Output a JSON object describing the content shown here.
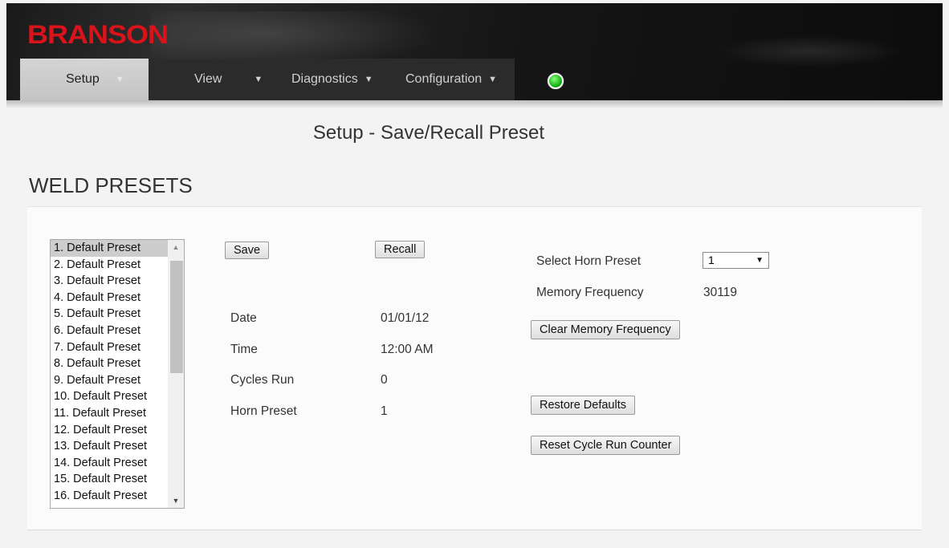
{
  "brand": {
    "name": "BRANSON"
  },
  "nav": {
    "items": [
      {
        "label": "Setup"
      },
      {
        "label": "View"
      },
      {
        "label": "Diagnostics"
      },
      {
        "label": "Configuration"
      }
    ],
    "dropdown_icon": "triangle-down-icon",
    "status_indicator": {
      "icon": "status-led-icon",
      "color": "#16b516"
    }
  },
  "page": {
    "title": "Setup - Save/Recall Preset"
  },
  "section": {
    "title": "WELD PRESETS"
  },
  "presets": {
    "items": [
      "1. Default Preset",
      "2. Default Preset",
      "3. Default Preset",
      "4. Default Preset",
      "5. Default Preset",
      "6. Default Preset",
      "7. Default Preset",
      "8. Default Preset",
      "9. Default Preset",
      "10. Default Preset",
      "11. Default Preset",
      "12. Default Preset",
      "13. Default Preset",
      "14. Default Preset",
      "15. Default Preset",
      "16. Default Preset"
    ],
    "selected_index": 0
  },
  "actions": {
    "save": "Save",
    "recall": "Recall",
    "clear_memory_frequency": "Clear Memory Frequency",
    "restore_defaults": "Restore Defaults",
    "reset_cycle_run_counter": "Reset Cycle Run Counter"
  },
  "info": {
    "date_label": "Date",
    "date_value": "01/01/12",
    "time_label": "Time",
    "time_value": "12:00 AM",
    "cycles_label": "Cycles Run",
    "cycles_value": "0",
    "horn_label": "Horn Preset",
    "horn_value": "1"
  },
  "horn": {
    "select_label": "Select Horn Preset",
    "select_value": "1",
    "memory_frequency_label": "Memory Frequency",
    "memory_frequency_value": "30119"
  }
}
